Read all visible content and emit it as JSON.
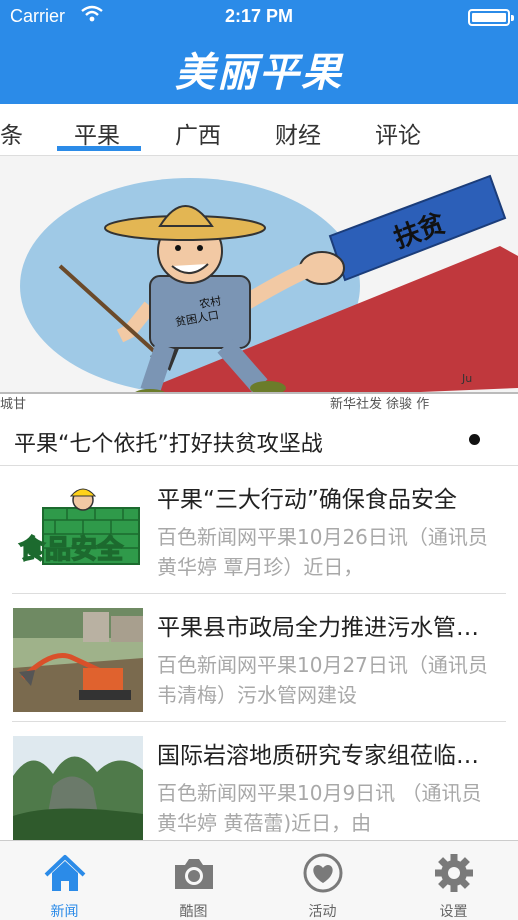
{
  "status_bar": {
    "carrier": "Carrier",
    "time": "2:17 PM"
  },
  "header": {
    "logo_text": "美丽平果"
  },
  "category_tabs": {
    "items": [
      {
        "label": "条"
      },
      {
        "label": "平果",
        "active": true
      },
      {
        "label": "广西"
      },
      {
        "label": "财经"
      },
      {
        "label": "评论"
      }
    ]
  },
  "banner": {
    "title": "平果“七个依托”打好扶贫攻坚战",
    "image_text": {
      "sign": "扶贫",
      "shirt_line1": "农村",
      "shirt_line2": "贫困人口",
      "credit_left": "城甘",
      "credit_right": "新华社发 徐骏 作",
      "artist": "Ju"
    }
  },
  "news": [
    {
      "title": "平果“三大行动”确保食品安全",
      "summary": "百色新闻网平果10月26日讯（通讯员 黄华婷 覃月珍）近日，",
      "thumb": "food-safety-thumbnail",
      "thumb_text": "食品安全"
    },
    {
      "title": "平果县市政局全力推进污水管网建设",
      "summary": "百色新闻网平果10月27日讯（通讯员 韦清梅）污水管网建设",
      "thumb": "excavator-thumbnail"
    },
    {
      "title": "国际岩溶地质研究专家组莅临平果",
      "summary": "百色新闻网平果10月9日讯 （通讯员 黄华婷 黄蓓蕾)近日，由",
      "thumb": "karst-landscape-thumbnail"
    }
  ],
  "tabbar": {
    "items": [
      {
        "label": "新闻",
        "icon": "home-icon",
        "active": true
      },
      {
        "label": "酷图",
        "icon": "camera-icon"
      },
      {
        "label": "活动",
        "icon": "heart-icon"
      },
      {
        "label": "设置",
        "icon": "gear-icon"
      }
    ]
  },
  "colors": {
    "brand": "#2b8be8",
    "text": "#222222",
    "muted": "#a8a8a8",
    "tab_inactive": "#666666"
  }
}
